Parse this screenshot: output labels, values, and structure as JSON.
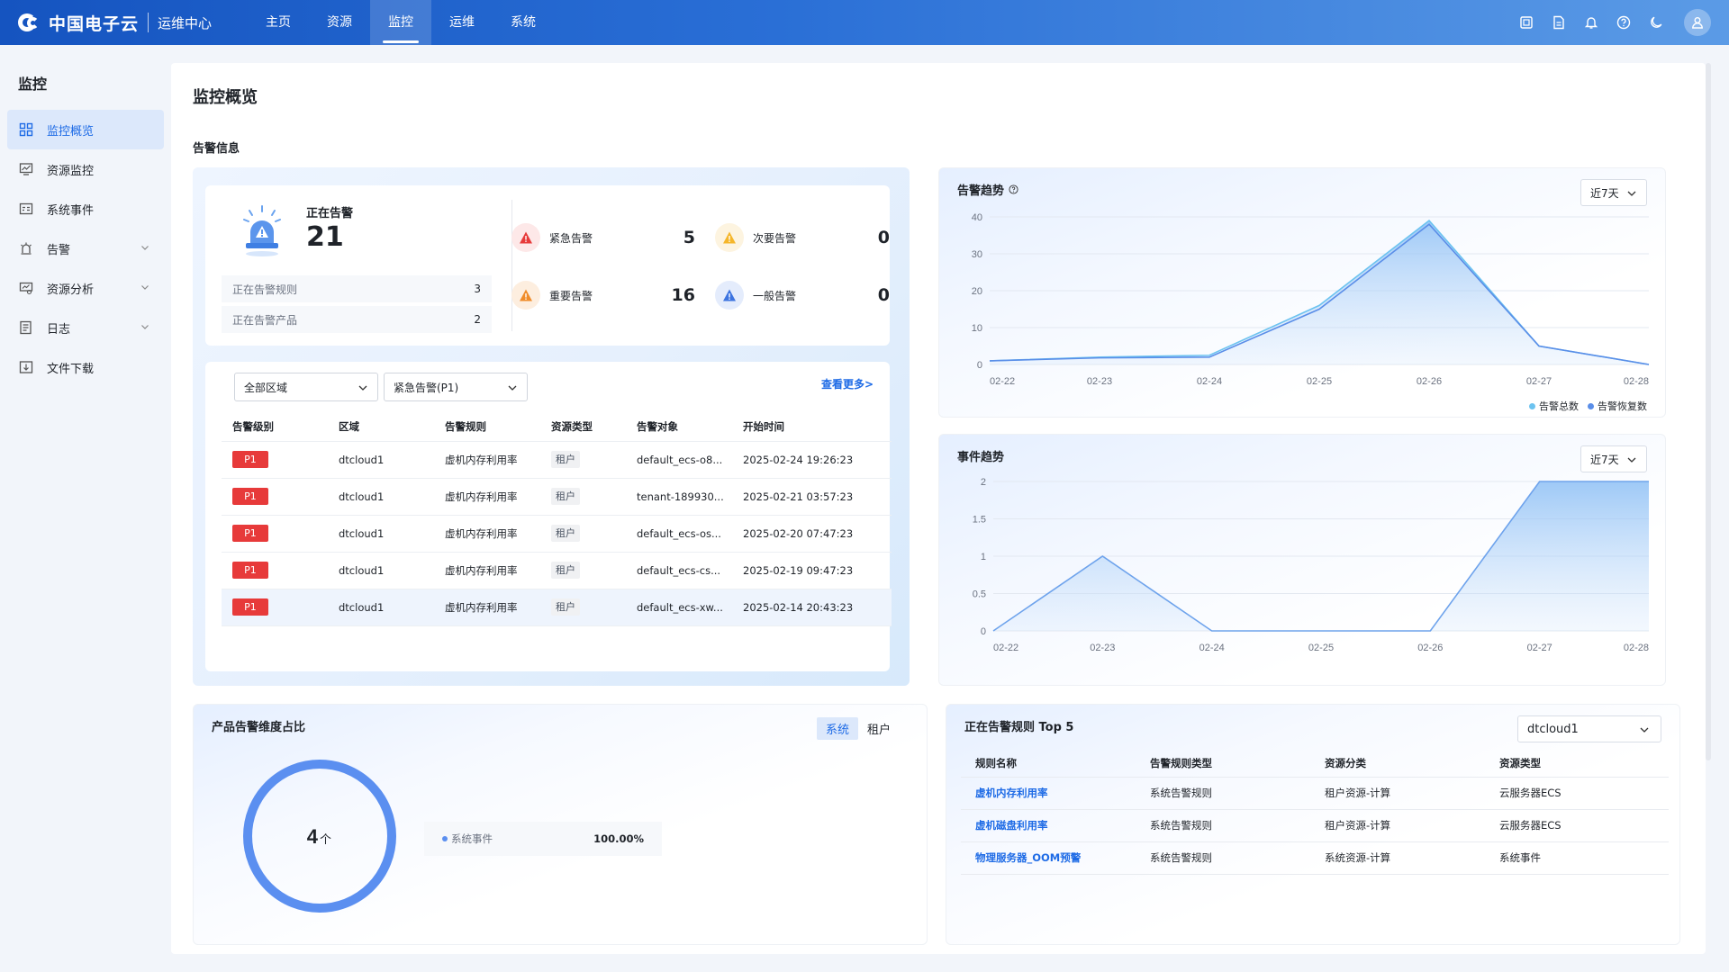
{
  "header": {
    "brand": "中国电子云",
    "subtitle": "运维中心",
    "nav": [
      {
        "label": "主页",
        "name": "nav-home"
      },
      {
        "label": "资源",
        "name": "nav-resources"
      },
      {
        "label": "监控",
        "name": "nav-monitor",
        "active": true
      },
      {
        "label": "运维",
        "name": "nav-ops"
      },
      {
        "label": "系统",
        "name": "nav-system"
      }
    ],
    "icons": [
      "screen-icon",
      "document-icon",
      "bell-icon",
      "help-icon",
      "moon-icon",
      "user-icon"
    ]
  },
  "sidebar": {
    "title": "监控",
    "items": [
      {
        "label": "监控概览",
        "icon": "grid-icon",
        "active": true
      },
      {
        "label": "资源监控",
        "icon": "monitor-chart-icon"
      },
      {
        "label": "系统事件",
        "icon": "event-list-icon"
      },
      {
        "label": "告警",
        "icon": "siren-icon",
        "expandable": true
      },
      {
        "label": "资源分析",
        "icon": "analysis-icon",
        "expandable": true
      },
      {
        "label": "日志",
        "icon": "log-icon",
        "expandable": true
      },
      {
        "label": "文件下载",
        "icon": "download-icon"
      }
    ]
  },
  "page": {
    "title": "监控概览",
    "alarm_section_title": "告警信息"
  },
  "alarm_summary": {
    "label": "正在告警",
    "count": "21",
    "rules_label": "正在告警规则",
    "rules_count": "3",
    "products_label": "正在告警产品",
    "products_count": "2",
    "levels": [
      {
        "label": "紧急告警",
        "count": "5",
        "color": "#e73a3a"
      },
      {
        "label": "次要告警",
        "count": "0",
        "color": "#f5b62a"
      },
      {
        "label": "重要告警",
        "count": "16",
        "color": "#f08c2a"
      },
      {
        "label": "一般告警",
        "count": "0",
        "color": "#3d74e0"
      }
    ]
  },
  "alarm_list": {
    "region_select": "全部区域",
    "level_select": "紧急告警(P1)",
    "more_link": "查看更多>",
    "columns": [
      "告警级别",
      "区域",
      "告警规则",
      "资源类型",
      "告警对象",
      "开始时间"
    ],
    "rows": [
      {
        "level": "P1",
        "region": "dtcloud1",
        "rule": "虚机内存利用率",
        "type": "租户",
        "target": "default_ecs-o8...",
        "time": "2025-02-24 19:26:23"
      },
      {
        "level": "P1",
        "region": "dtcloud1",
        "rule": "虚机内存利用率",
        "type": "租户",
        "target": "tenant-189930...",
        "time": "2025-02-21 03:57:23"
      },
      {
        "level": "P1",
        "region": "dtcloud1",
        "rule": "虚机内存利用率",
        "type": "租户",
        "target": "default_ecs-os...",
        "time": "2025-02-20 07:47:23"
      },
      {
        "level": "P1",
        "region": "dtcloud1",
        "rule": "虚机内存利用率",
        "type": "租户",
        "target": "default_ecs-cs...",
        "time": "2025-02-19 09:47:23"
      },
      {
        "level": "P1",
        "region": "dtcloud1",
        "rule": "虚机内存利用率",
        "type": "租户",
        "target": "default_ecs-xw...",
        "time": "2025-02-14 20:43:23"
      }
    ]
  },
  "chart_data": [
    {
      "type": "area",
      "title": "告警趋势",
      "range_select": "近7天",
      "categories": [
        "02-22",
        "02-23",
        "02-24",
        "02-25",
        "02-26",
        "02-27",
        "02-28"
      ],
      "ylim": [
        0,
        40
      ],
      "yticks": [
        0,
        10,
        20,
        30,
        40
      ],
      "series": [
        {
          "name": "告警总数",
          "color": "#6cc3f0",
          "values": [
            1,
            2,
            2.5,
            16,
            39,
            5,
            0
          ]
        },
        {
          "name": "告警恢复数",
          "color": "#5a8ee8",
          "values": [
            1,
            1.8,
            2,
            15,
            38,
            5,
            0
          ]
        }
      ],
      "legend": "bottom-right"
    },
    {
      "type": "area",
      "title": "事件趋势",
      "range_select": "近7天",
      "categories": [
        "02-22",
        "02-23",
        "02-24",
        "02-25",
        "02-26",
        "02-27",
        "02-28"
      ],
      "ylim": [
        0,
        2
      ],
      "yticks": [
        "0",
        "0.5",
        "1",
        "1.5",
        "2"
      ],
      "series": [
        {
          "color": "#6ea3ec",
          "values": [
            0,
            1,
            0,
            0,
            0,
            2,
            2
          ]
        }
      ]
    },
    {
      "type": "pie",
      "title": "产品告警维度占比",
      "tabs": [
        "系统",
        "租户"
      ],
      "active_tab": "系统",
      "center_value": "4",
      "center_unit": "个",
      "slices": [
        {
          "name": "系统事件",
          "value": 100.0,
          "percent": "100.00%",
          "color": "#5b8ff0"
        }
      ]
    }
  ],
  "top_rules": {
    "title": "正在告警规则 Top 5",
    "region_select": "dtcloud1",
    "columns": [
      "规则名称",
      "告警规则类型",
      "资源分类",
      "资源类型"
    ],
    "rows": [
      {
        "name": "虚机内存利用率",
        "rule_type": "系统告警规则",
        "category": "租户资源-计算",
        "res_type": "云服务器ECS"
      },
      {
        "name": "虚机磁盘利用率",
        "rule_type": "系统告警规则",
        "category": "租户资源-计算",
        "res_type": "云服务器ECS"
      },
      {
        "name": "物理服务器_OOM预警",
        "rule_type": "系统告警规则",
        "category": "系统资源-计算",
        "res_type": "系统事件"
      }
    ]
  }
}
